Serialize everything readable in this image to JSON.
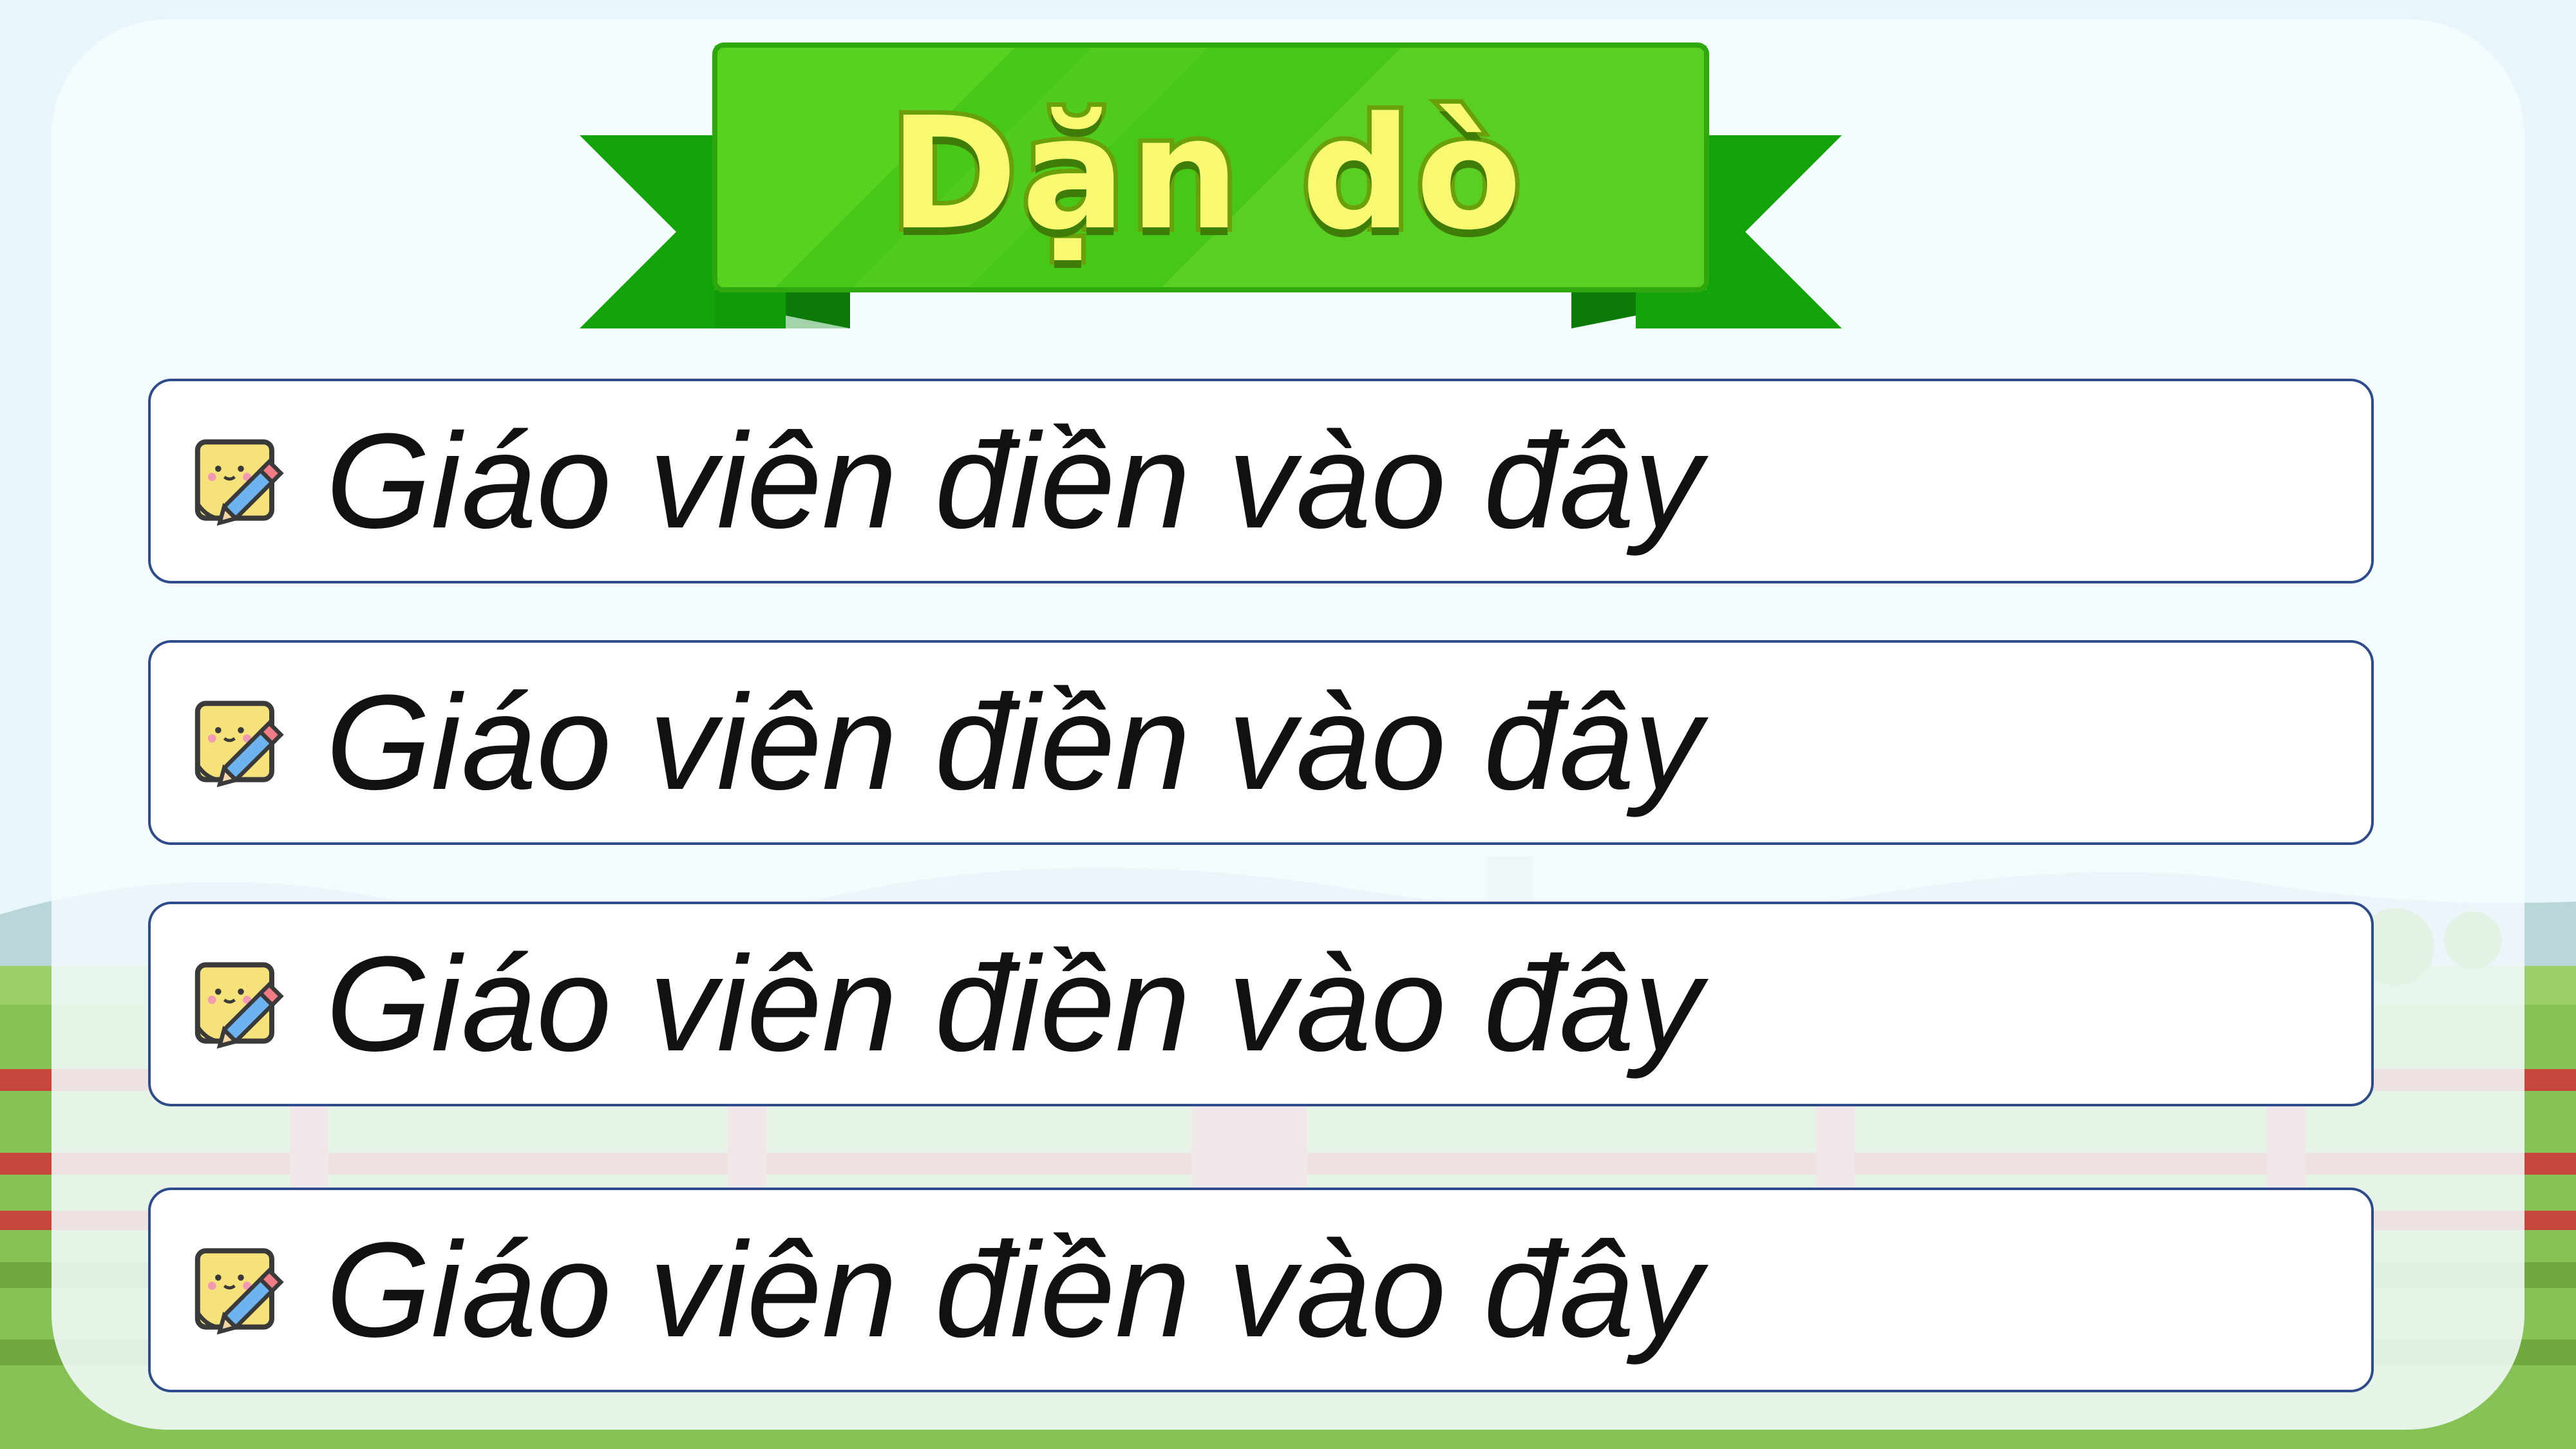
{
  "slide": {
    "title": "Dặn dò",
    "items": [
      {
        "text": "Giáo viên điền vào đây",
        "icon": "note-pencil-icon"
      },
      {
        "text": "Giáo viên điền vào đây",
        "icon": "note-pencil-icon"
      },
      {
        "text": "Giáo viên điền vào đây",
        "icon": "note-pencil-icon"
      },
      {
        "text": "Giáo viên điền vào đây",
        "icon": "note-pencil-icon"
      }
    ]
  },
  "colors": {
    "ribbon_green": "#3fc20f",
    "ribbon_dark_green": "#13a30a",
    "title_yellow": "#f8f871",
    "box_border": "#2e4b8b",
    "grass": "#7dbc4a",
    "fence": "#c8473c"
  }
}
